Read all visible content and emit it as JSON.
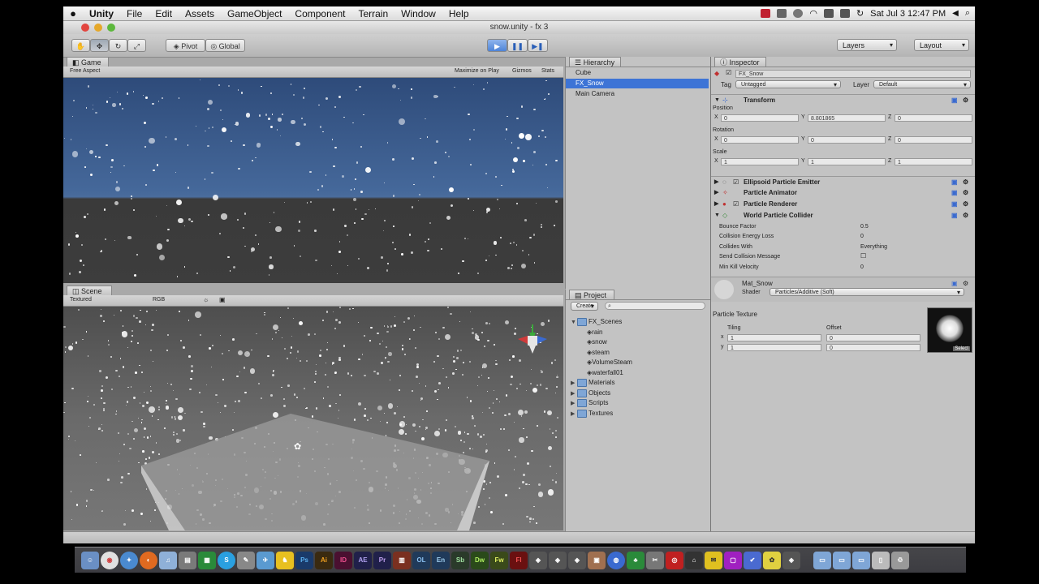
{
  "menubar": {
    "app_name": "Unity",
    "items": [
      "File",
      "Edit",
      "Assets",
      "GameObject",
      "Component",
      "Terrain",
      "Window",
      "Help"
    ],
    "clock": "Sat Jul 3  12:47 PM"
  },
  "window": {
    "title": "snow.unity - fx 3"
  },
  "toolbar": {
    "pivot_label": "Pivot",
    "global_label": "Global",
    "layers_label": "Layers",
    "layout_label": "Layout"
  },
  "game_panel": {
    "tab_label": "Game",
    "aspect_label": "Free Aspect",
    "maximize_label": "Maximize on Play",
    "gizmos_label": "Gizmos",
    "stats_label": "Stats"
  },
  "scene_panel": {
    "tab_label": "Scene",
    "render_mode": "Textured",
    "color_mode": "RGB"
  },
  "hierarchy": {
    "tab_label": "Hierarchy",
    "items": [
      "Cube",
      "FX_Snow",
      "Main Camera"
    ],
    "selected_index": 1
  },
  "project": {
    "tab_label": "Project",
    "create_label": "Create",
    "root_folder": "FX_Scenes",
    "scenes": [
      "rain",
      "snow",
      "steam",
      "VolumeSteam",
      "waterfall01"
    ],
    "folders": [
      "Materials",
      "Objects",
      "Scripts",
      "Textures"
    ]
  },
  "inspector": {
    "tab_label": "Inspector",
    "object_name": "FX_Snow",
    "tag_label": "Tag",
    "tag_value": "Untagged",
    "layer_label": "Layer",
    "layer_value": "Default",
    "transform": {
      "title": "Transform",
      "position_label": "Position",
      "position": {
        "x": "0",
        "y": "8.801865",
        "z": "0"
      },
      "rotation_label": "Rotation",
      "rotation": {
        "x": "0",
        "y": "0",
        "z": "0"
      },
      "scale_label": "Scale",
      "scale": {
        "x": "1",
        "y": "1",
        "z": "1"
      }
    },
    "components": [
      "Ellipsoid Particle Emitter",
      "Particle Animator",
      "Particle Renderer",
      "World Particle Collider"
    ],
    "collider_props": [
      {
        "label": "Bounce Factor",
        "value": "0.5"
      },
      {
        "label": "Collision Energy Loss",
        "value": "0"
      },
      {
        "label": "Collides With",
        "value": "Everything"
      },
      {
        "label": "Send Collision Message",
        "value": ""
      },
      {
        "label": "Min Kill Velocity",
        "value": "0"
      }
    ],
    "material": {
      "name": "Mat_Snow",
      "shader_label": "Shader",
      "shader_value": "Particles/Additive (Soft)",
      "texture_label": "Particle Texture",
      "tiling_label": "Tiling",
      "offset_label": "Offset",
      "x_label": "x",
      "y_label": "y",
      "tiling_x": "1",
      "tiling_y": "1",
      "offset_x": "0",
      "offset_y": "0",
      "select_label": "Select"
    }
  },
  "dock": {
    "labeled_apps": [
      "Ps",
      "Ai",
      "ID",
      "AE",
      "Pr",
      "OL",
      "En",
      "Sb",
      "Dw",
      "Fw",
      "Fl"
    ]
  },
  "colors": {
    "selection": "#3d74d6",
    "game_sky": "#3a5d92",
    "panel_bg": "#c3c3c3"
  }
}
